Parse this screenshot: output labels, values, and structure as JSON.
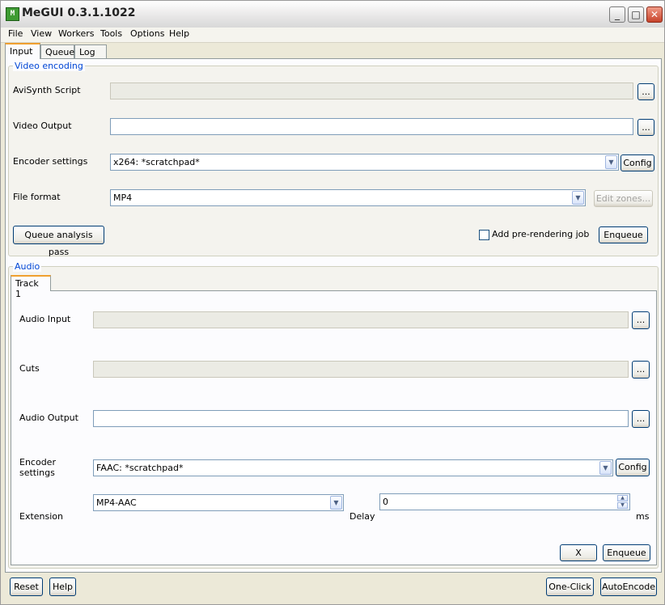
{
  "window": {
    "title": "MeGUI 0.3.1.1022",
    "app_icon": "megui-app-icon",
    "controls": {
      "minimize": "_",
      "maximize": "□",
      "close": "✕"
    }
  },
  "menu": {
    "items": [
      "File",
      "View",
      "Workers",
      "Tools",
      "Options",
      "Help"
    ]
  },
  "tabs": [
    "Input",
    "Queue",
    "Log"
  ],
  "video": {
    "group_label": "Video encoding",
    "avisynth_label": "AviSynth Script",
    "avisynth_value": "",
    "video_output_label": "Video Output",
    "video_output_value": "",
    "encoder_label": "Encoder settings",
    "encoder_value": "x264: *scratchpad*",
    "config_label": "Config",
    "file_format_label": "File format",
    "file_format_value": "MP4",
    "edit_zones_label": "Edit zones...",
    "queue_analysis_label": "Queue analysis pass",
    "add_prerender_label": "Add pre-rendering job",
    "add_prerender_checked": false,
    "enqueue_label": "Enqueue",
    "browse_label": "..."
  },
  "audio": {
    "group_label": "Audio",
    "track_tab": "Track 1",
    "audio_input_label": "Audio Input",
    "audio_input_value": "",
    "cuts_label": "Cuts",
    "cuts_value": "",
    "audio_output_label": "Audio Output",
    "audio_output_value": "",
    "encoder_label_line1": "Encoder",
    "encoder_label_line2": "settings",
    "encoder_value": "FAAC: *scratchpad*",
    "config_label": "Config",
    "extension_label": "Extension",
    "extension_value": "MP4-AAC",
    "delay_label": "Delay",
    "delay_value": "0",
    "ms_label": "ms",
    "x_label": "X",
    "enqueue_label": "Enqueue",
    "browse_label": "..."
  },
  "bottom": {
    "reset_label": "Reset",
    "help_label": "Help",
    "one_click_label": "One-Click",
    "autoencode_label": "AutoEncode"
  }
}
